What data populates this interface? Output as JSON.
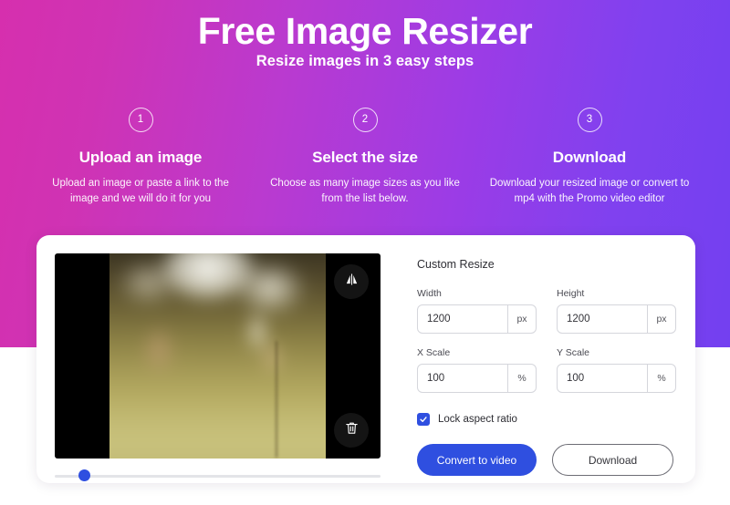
{
  "hero": {
    "title": "Free Image Resizer",
    "subtitle": "Resize images in 3 easy steps",
    "gradient_start": "#d62fae",
    "gradient_end": "#7340f0"
  },
  "steps": [
    {
      "number": "1",
      "title": "Upload an image",
      "desc": "Upload an image or paste a link to the image and we will do it for you"
    },
    {
      "number": "2",
      "title": "Select the size",
      "desc": "Choose as many image sizes as you like from the list below."
    },
    {
      "number": "3",
      "title": "Download",
      "desc": "Download your resized image or convert to mp4 with the Promo video editor"
    }
  ],
  "preview": {
    "flip_icon": "flip-horizontal-icon",
    "delete_icon": "trash-icon",
    "slider_value": 8
  },
  "panel": {
    "title": "Custom Resize",
    "fields": [
      {
        "label": "Width",
        "value": "1200",
        "unit": "px"
      },
      {
        "label": "Height",
        "value": "1200",
        "unit": "px"
      },
      {
        "label": "X Scale",
        "value": "100",
        "unit": "%"
      },
      {
        "label": "Y Scale",
        "value": "100",
        "unit": "%"
      }
    ],
    "lock_aspect_ratio": {
      "label": "Lock aspect ratio",
      "checked": true
    },
    "buttons": {
      "primary": "Convert to video",
      "secondary": "Download"
    },
    "accent_color": "#2f4fe0"
  }
}
